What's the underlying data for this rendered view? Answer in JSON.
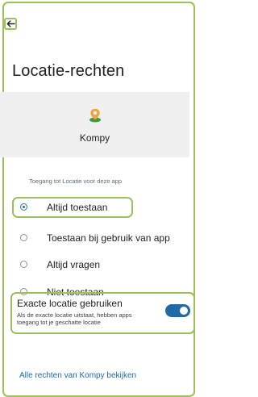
{
  "header": {
    "back_icon": "arrow-left-icon",
    "title": "Locatie-rechten"
  },
  "app": {
    "icon": "kompy-location-pin-icon",
    "name": "Kompy"
  },
  "permissions": {
    "section_label": "Toegang tot Locatie voor deze app",
    "options": [
      {
        "label": "Altijd toestaan",
        "selected": true
      },
      {
        "label": "Toestaan bij gebruik van app",
        "selected": false
      },
      {
        "label": "Altijd vragen",
        "selected": false
      },
      {
        "label": "Niet toestaan",
        "selected": false
      }
    ]
  },
  "exact_location": {
    "title": "Exacte locatie gebruiken",
    "description": "Als de exacte locatie uitstaat, hebben apps toegang tot je geschatte locatie",
    "enabled": true
  },
  "footer": {
    "all_rights_link": "Alle rechten van Kompy bekijken"
  },
  "colors": {
    "highlight_outline": "#9bc15a",
    "accent_blue": "#1f6ba5",
    "app_band": "#f0f0f0"
  }
}
